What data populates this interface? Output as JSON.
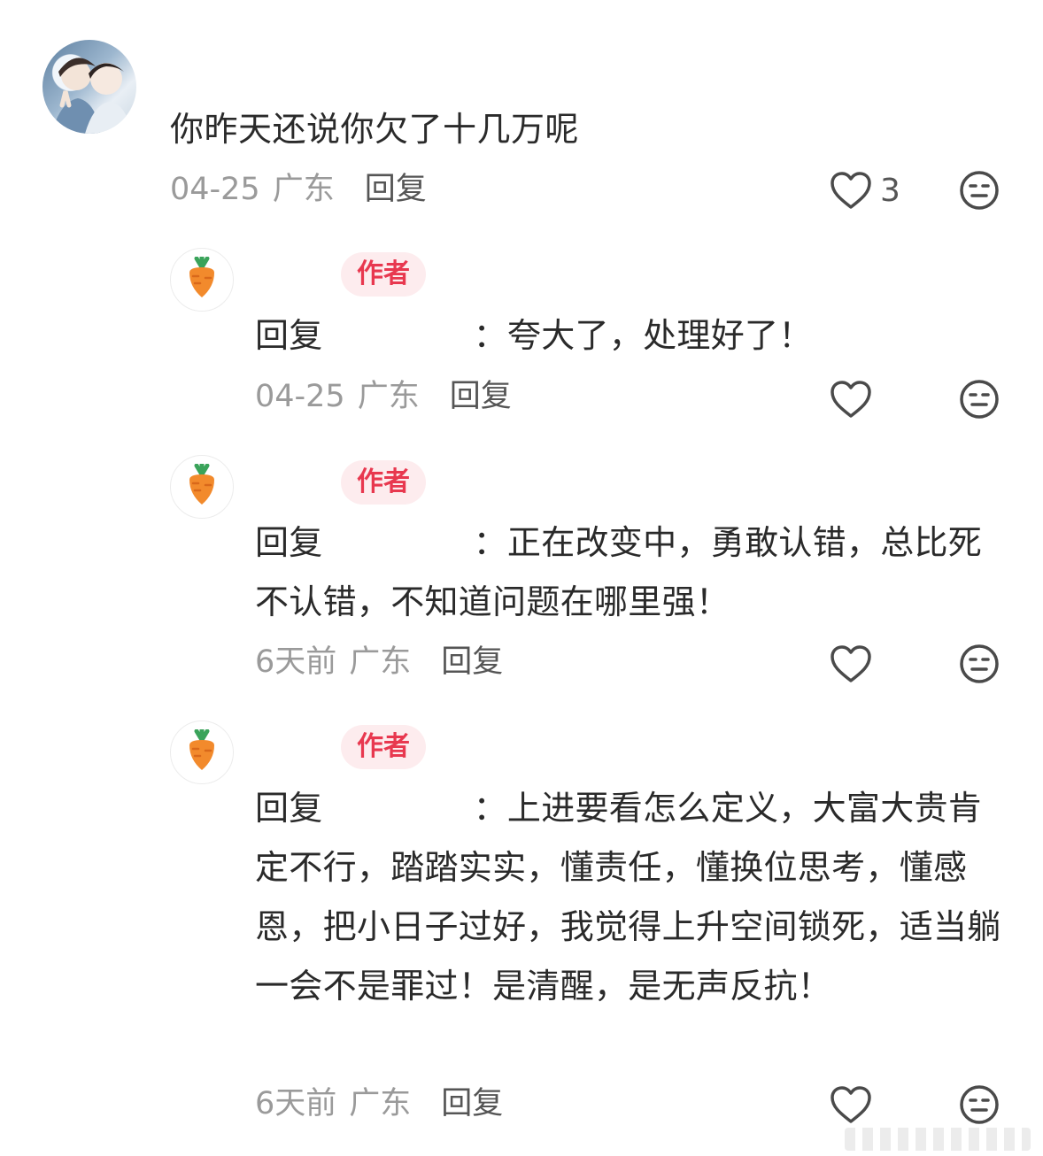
{
  "main_comment": {
    "text": "你昨天还说你欠了十几万呢",
    "date": "04-25",
    "location": "广东",
    "reply_label": "回复",
    "like_count": "3"
  },
  "replies": [
    {
      "author_tag": "作者",
      "reply_prefix": "回复",
      "text": "：夸大了，处理好了！",
      "date": "04-25",
      "location": "广东",
      "reply_label": "回复"
    },
    {
      "author_tag": "作者",
      "reply_prefix": "回复",
      "text": "：正在改变中，勇敢认错，总比死不认错，不知道问题在哪里强！",
      "date": "6天前",
      "location": "广东",
      "reply_label": "回复"
    },
    {
      "author_tag": "作者",
      "reply_prefix": "回复",
      "text": "：上进要看怎么定义，大富大贵肯定不行，踏踏实实，懂责任，懂换位思考，懂感恩，把小日子过好，我觉得上升空间锁死，适当躺一会不是罪过！是清醒，是无声反抗！",
      "date": "6天前",
      "location": "广东",
      "reply_label": "回复"
    }
  ],
  "icons": {
    "like": "heart-outline-icon",
    "dislike": "meh-face-icon",
    "author_avatar": "carrot-icon"
  },
  "colors": {
    "author_tag_text": "#e8384f",
    "author_tag_bg": "#fdecee",
    "meta_text": "#9a9a9a"
  }
}
